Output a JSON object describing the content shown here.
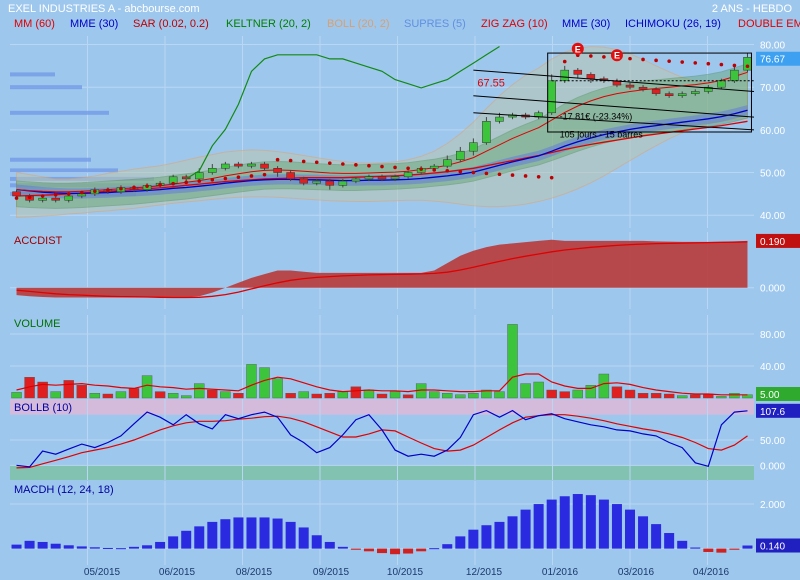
{
  "header": {
    "title": "EXEL INDUSTRIES A - abcbourse.com",
    "period": "2 ANS - HEBDO"
  },
  "legend": [
    {
      "label": "MM (60)",
      "color": "#e00000"
    },
    {
      "label": "MME (30)",
      "color": "#0000c8"
    },
    {
      "label": "SAR (0.02, 0.2)",
      "color": "#c00000"
    },
    {
      "label": "KELTNER (20, 2)",
      "color": "#008000"
    },
    {
      "label": "BOLL (20, 2)",
      "color": "#d8a070"
    },
    {
      "label": "SUPRES (5)",
      "color": "#6090e0"
    },
    {
      "label": "ZIG ZAG (10)",
      "color": "#e00000"
    },
    {
      "label": "MME (30)",
      "color": "#0000c8"
    },
    {
      "label": "ICHIMOKU (26, 19)",
      "color": "#0000c8"
    },
    {
      "label": "DOUBLE EM",
      "color": "#e00000"
    }
  ],
  "x_labels": [
    "05/2015",
    "06/2015",
    "08/2015",
    "09/2015",
    "10/2015",
    "12/2015",
    "01/2016",
    "03/2016",
    "04/2016"
  ],
  "chart_data": [
    {
      "type": "line",
      "name": "price",
      "y_ticks": [
        "80.00",
        "70.00",
        "60.00",
        "50.00",
        "40.00"
      ],
      "ylim": [
        37,
        82
      ],
      "last_value": "76.67",
      "annotations": {
        "level": "67.55",
        "change": "-17.81€ (-23.34%)",
        "duration": "105 jours - 15 barres",
        "markers": [
          "E",
          "E"
        ]
      },
      "candles": [
        [
          45.5,
          44.5,
          46,
          44
        ],
        [
          44.5,
          43.5,
          45,
          43
        ],
        [
          43.5,
          44,
          44.5,
          43
        ],
        [
          44,
          43.5,
          44.5,
          43
        ],
        [
          43.5,
          44.5,
          45,
          43
        ],
        [
          44.5,
          45,
          45.5,
          44
        ],
        [
          45,
          46,
          46.5,
          44.5
        ],
        [
          46,
          45.5,
          46.5,
          45
        ],
        [
          45.5,
          46.5,
          47,
          45
        ],
        [
          46.5,
          46,
          47,
          45.5
        ],
        [
          46,
          47,
          47.5,
          45.5
        ],
        [
          47,
          47.5,
          48,
          46.5
        ],
        [
          47.5,
          49,
          49.5,
          47
        ],
        [
          49,
          48.5,
          49.5,
          48
        ],
        [
          48.5,
          50,
          51,
          48
        ],
        [
          50,
          51,
          52,
          49.5
        ],
        [
          51,
          52,
          52.5,
          50.5
        ],
        [
          52,
          51.5,
          52.5,
          51
        ],
        [
          51.5,
          52,
          52.5,
          51
        ],
        [
          52,
          51,
          52.5,
          50.5
        ],
        [
          51,
          50,
          51.5,
          49
        ],
        [
          50,
          48.5,
          50.5,
          48
        ],
        [
          48.5,
          47.5,
          49,
          47
        ],
        [
          47.5,
          48,
          48.5,
          47
        ],
        [
          48,
          47,
          48.5,
          46
        ],
        [
          47,
          48,
          48.5,
          46.5
        ],
        [
          48,
          48.5,
          49,
          47.5
        ],
        [
          48.5,
          49,
          49.5,
          48
        ],
        [
          49,
          48.5,
          49.5,
          48
        ],
        [
          48.5,
          49,
          49.5,
          48
        ],
        [
          49,
          50,
          50.5,
          48.5
        ],
        [
          50,
          51,
          51.5,
          49.5
        ],
        [
          51,
          51.5,
          52,
          50.5
        ],
        [
          51.5,
          53,
          54,
          51
        ],
        [
          53,
          55,
          56,
          52.5
        ],
        [
          55,
          57,
          58,
          54
        ],
        [
          57,
          62,
          63,
          56.5
        ],
        [
          62,
          63,
          64,
          61.5
        ],
        [
          63,
          63.5,
          64,
          62.5
        ],
        [
          63.5,
          63,
          64,
          62.5
        ],
        [
          63,
          64,
          64.5,
          62.5
        ],
        [
          64,
          71.5,
          73,
          63.5
        ],
        [
          71.5,
          74,
          75,
          71
        ],
        [
          74,
          73,
          74.5,
          72
        ],
        [
          73,
          72,
          73.5,
          71
        ],
        [
          72,
          71.5,
          72.5,
          71
        ],
        [
          71.5,
          70.5,
          72,
          70
        ],
        [
          70.5,
          70,
          71,
          69.5
        ],
        [
          70,
          69.5,
          70.5,
          69
        ],
        [
          69.5,
          68.5,
          70,
          68
        ],
        [
          68.5,
          68,
          69,
          67.5
        ],
        [
          68,
          68.5,
          69,
          67.5
        ],
        [
          68.5,
          69,
          69.5,
          68
        ],
        [
          69,
          70,
          70.5,
          68.5
        ],
        [
          70,
          71.5,
          72,
          69.5
        ],
        [
          71.5,
          74,
          75,
          71
        ],
        [
          74,
          77,
          78,
          73.5
        ]
      ],
      "mm60": [
        44.5,
        44.6,
        44.7,
        44.8,
        45,
        45.2,
        45.4,
        45.6,
        45.8,
        46,
        46.2,
        46.4,
        46.7,
        47,
        47.3,
        47.6,
        47.9,
        48.1,
        48.3,
        48.5,
        48.6,
        48.7,
        48.8,
        48.8,
        48.8,
        48.8,
        48.9,
        49,
        49.1,
        49.2,
        49.4,
        49.6,
        49.9,
        50.2,
        50.6,
        51,
        51.6,
        52.2,
        52.8,
        53.4,
        54,
        54.7,
        55.4,
        56,
        56.6,
        57.1,
        57.6,
        58.1,
        58.6,
        59,
        59.4,
        59.8,
        60.2,
        60.6,
        61,
        61.5,
        62
      ],
      "mme30": [
        46,
        45.7,
        45.4,
        45.2,
        45.1,
        45.1,
        45.2,
        45.3,
        45.5,
        45.6,
        45.8,
        46,
        46.3,
        46.5,
        46.8,
        47.1,
        47.5,
        47.8,
        48.1,
        48.3,
        48.4,
        48.4,
        48.3,
        48.3,
        48.2,
        48.1,
        48.1,
        48.2,
        48.2,
        48.3,
        48.4,
        48.6,
        48.9,
        49.2,
        49.6,
        50.1,
        50.9,
        51.7,
        52.5,
        53.2,
        53.9,
        55,
        56.2,
        57.2,
        58.1,
        58.9,
        59.5,
        60.1,
        60.6,
        61,
        61.4,
        61.8,
        62.2,
        62.6,
        63.1,
        63.8,
        64.6
      ],
      "sar": [
        44,
        44.2,
        44.5,
        44.8,
        45,
        45.3,
        45.6,
        45.9,
        46.2,
        46.5,
        46.8,
        47.1,
        47.4,
        47.7,
        48,
        48.3,
        48.6,
        48.9,
        49.2,
        49.5,
        53,
        52.8,
        52.6,
        52.4,
        52.2,
        52,
        51.8,
        51.6,
        51.4,
        51.2,
        51,
        50.8,
        50.6,
        50.4,
        50.2,
        50,
        49.8,
        49.6,
        49.4,
        49.2,
        49,
        48.8,
        76,
        77.5,
        77.3,
        77.1,
        76.9,
        76.7,
        76.5,
        76.3,
        76.1,
        75.9,
        75.7,
        75.5,
        75.3,
        75.1,
        74.9
      ],
      "keltner_upper": [
        48,
        47.8,
        47.6,
        47.5,
        47.5,
        47.6,
        47.8,
        48,
        48.2,
        48.4,
        48.6,
        48.9,
        49.3,
        49.7,
        50.1,
        50.6,
        51.2,
        51.7,
        52.2,
        52.5,
        52.6,
        52.5,
        52.3,
        52.1,
        51.9,
        51.8,
        51.8,
        51.9,
        52,
        52.1,
        52.3,
        52.7,
        53.1,
        53.7,
        54.5,
        55.5,
        57,
        58.5,
        60,
        61.3,
        62.5,
        64.3,
        66.1,
        67.6,
        68.8,
        69.8,
        70.5,
        71,
        71.4,
        71.7,
        72,
        72.3,
        72.6,
        73,
        73.6,
        74.5,
        75.5
      ],
      "keltner_lower": [
        42,
        41.8,
        41.7,
        41.6,
        41.7,
        41.8,
        42,
        42.2,
        42.4,
        42.6,
        42.9,
        43.2,
        43.5,
        43.8,
        44.2,
        44.6,
        45,
        45.4,
        45.8,
        46.1,
        46.2,
        46.2,
        46.1,
        46,
        45.9,
        45.8,
        45.8,
        45.9,
        46,
        46.1,
        46.3,
        46.5,
        46.8,
        47.1,
        47.5,
        48,
        48.8,
        49.6,
        50.4,
        51.1,
        51.8,
        52.8,
        53.9,
        55,
        56,
        56.9,
        57.6,
        58.2,
        58.7,
        59.2,
        59.6,
        60,
        60.4,
        60.8,
        61.3,
        62,
        62.8
      ],
      "boll_upper": [
        50,
        49.5,
        49,
        48.5,
        48.5,
        48.8,
        49.2,
        49.8,
        50.3,
        50.8,
        51.2,
        51.6,
        52.2,
        52.9,
        53.6,
        54.2,
        54.8,
        55.1,
        55.3,
        55.2,
        54.9,
        54.5,
        54,
        53.5,
        53,
        52.6,
        52.3,
        52.2,
        52.3,
        52.5,
        53,
        53.8,
        55,
        56.8,
        59.1,
        61.8,
        65,
        68,
        70.6,
        72.8,
        74.5,
        76.6,
        78.2,
        79.1,
        79.5,
        79.4,
        78.8,
        77.8,
        76.5,
        75,
        73.6,
        72.3,
        71.4,
        71,
        71.3,
        72.4,
        74.2
      ],
      "boll_lower": [
        39.5,
        39.6,
        39.8,
        40,
        40.3,
        40.5,
        40.8,
        41,
        41.3,
        41.6,
        42,
        42.4,
        42.8,
        43.1,
        43.4,
        43.7,
        44,
        44.2,
        44.3,
        44.3,
        44.2,
        44,
        43.8,
        43.6,
        43.4,
        43.3,
        43.2,
        43.2,
        43.3,
        43.4,
        43.5,
        43.5,
        43.3,
        43,
        42.6,
        42.2,
        42,
        42,
        42.2,
        42.6,
        43.2,
        44,
        45,
        46.2,
        47.6,
        49.2,
        51,
        52.8,
        54.6,
        56.3,
        57.9,
        59.3,
        60.5,
        61.4,
        62,
        62.4,
        62.7
      ],
      "supres_levels": [
        [
          50.5,
          60
        ],
        [
          48.5,
          80
        ],
        [
          47,
          100
        ],
        [
          45,
          70
        ],
        [
          53,
          45
        ],
        [
          73,
          25
        ],
        [
          70,
          40
        ],
        [
          64,
          55
        ]
      ]
    },
    {
      "type": "area",
      "name": "ACCDIST",
      "y_ticks": [
        "0.000"
      ],
      "ylim": [
        -0.05,
        0.21
      ],
      "last_value": "0.190",
      "values": [
        -0.03,
        -0.035,
        -0.038,
        -0.04,
        -0.04,
        -0.04,
        -0.04,
        -0.04,
        -0.04,
        -0.04,
        -0.04,
        -0.04,
        -0.04,
        -0.04,
        -0.035,
        -0.02,
        0.0,
        0.02,
        0.04,
        0.055,
        0.07,
        0.07,
        0.065,
        0.06,
        0.06,
        0.06,
        0.06,
        0.06,
        0.06,
        0.06,
        0.06,
        0.06,
        0.07,
        0.1,
        0.13,
        0.15,
        0.165,
        0.175,
        0.18,
        0.185,
        0.19,
        0.195,
        0.19,
        0.19,
        0.19,
        0.19,
        0.19,
        0.19,
        0.19,
        0.188,
        0.187,
        0.186,
        0.186,
        0.186,
        0.187,
        0.188,
        0.19
      ],
      "signal": [
        -0.01,
        -0.015,
        -0.02,
        -0.025,
        -0.028,
        -0.03,
        -0.033,
        -0.035,
        -0.036,
        -0.037,
        -0.038,
        -0.039,
        -0.04,
        -0.04,
        -0.039,
        -0.035,
        -0.028,
        -0.018,
        -0.005,
        0.008,
        0.02,
        0.03,
        0.037,
        0.042,
        0.045,
        0.048,
        0.05,
        0.052,
        0.053,
        0.054,
        0.055,
        0.056,
        0.058,
        0.063,
        0.072,
        0.083,
        0.095,
        0.107,
        0.118,
        0.128,
        0.137,
        0.146,
        0.153,
        0.159,
        0.164,
        0.168,
        0.172,
        0.175,
        0.177,
        0.179,
        0.18,
        0.181,
        0.182,
        0.183,
        0.184,
        0.185,
        0.186
      ]
    },
    {
      "type": "bar",
      "name": "VOLUME",
      "y_ticks": [
        "80.00",
        "40.00"
      ],
      "ylim": [
        0,
        100
      ],
      "last_value": "5.00",
      "values": [
        7,
        26,
        20,
        8,
        22,
        16,
        6,
        5,
        8,
        12,
        28,
        8,
        6,
        3,
        18,
        10,
        8,
        6,
        42,
        38,
        24,
        6,
        8,
        5,
        6,
        8,
        14,
        10,
        5,
        8,
        4,
        18,
        8,
        6,
        4,
        6,
        10,
        8,
        92,
        18,
        20,
        10,
        8,
        10,
        16,
        30,
        14,
        10,
        6,
        6,
        5,
        3,
        4,
        5,
        2,
        6,
        4
      ],
      "up": [
        1,
        0,
        0,
        1,
        0,
        0,
        1,
        0,
        1,
        0,
        1,
        0,
        1,
        1,
        1,
        0,
        1,
        0,
        1,
        1,
        1,
        0,
        1,
        0,
        0,
        1,
        0,
        1,
        0,
        1,
        0,
        1,
        1,
        1,
        1,
        1,
        1,
        1,
        1,
        1,
        1,
        0,
        0,
        1,
        1,
        1,
        0,
        0,
        0,
        0,
        0,
        1,
        0,
        0,
        1,
        1,
        1
      ],
      "ma": [
        10,
        14,
        17,
        16,
        17,
        18,
        16,
        15,
        13,
        12,
        16,
        14,
        13,
        11,
        12,
        11,
        10,
        9,
        16,
        22,
        26,
        24,
        19,
        14,
        10,
        8,
        9,
        10,
        9,
        9,
        8,
        10,
        10,
        9,
        8,
        8,
        9,
        9,
        26,
        30,
        30,
        20,
        15,
        12,
        12,
        18,
        19,
        17,
        13,
        10,
        8,
        6,
        5,
        5,
        4,
        4,
        4
      ]
    },
    {
      "type": "line",
      "name": "BOLLB (10)",
      "y_ticks": [
        "50.00",
        "0.000"
      ],
      "ylim": [
        -25,
        125
      ],
      "last_value": "107.6",
      "values": [
        0,
        -3,
        28,
        22,
        32,
        42,
        35,
        45,
        58,
        82,
        105,
        95,
        80,
        100,
        82,
        72,
        100,
        92,
        100,
        105,
        95,
        60,
        45,
        25,
        35,
        60,
        90,
        100,
        70,
        30,
        18,
        22,
        18,
        30,
        55,
        100,
        108,
        95,
        108,
        90,
        98,
        102,
        92,
        86,
        80,
        76,
        70,
        68,
        62,
        58,
        45,
        35,
        5,
        -2,
        80,
        105,
        107.6
      ],
      "signal": [
        -5,
        -4,
        3,
        10,
        17,
        25,
        30,
        35,
        42,
        50,
        60,
        70,
        78,
        84,
        87,
        87,
        88,
        91,
        93,
        96,
        97,
        93,
        86,
        76,
        66,
        56,
        56,
        62,
        70,
        68,
        56,
        44,
        33,
        28,
        30,
        40,
        55,
        70,
        84,
        95,
        98,
        100,
        100,
        97,
        93,
        88,
        82,
        77,
        72,
        68,
        62,
        55,
        45,
        33,
        30,
        40,
        58
      ],
      "band_high": 100,
      "band_low": 0
    },
    {
      "type": "bar",
      "name": "MACDH (12, 24, 18)",
      "y_ticks": [
        "2.000",
        "0.000"
      ],
      "ylim": [
        -0.6,
        2.9
      ],
      "last_value": "0.140",
      "values": [
        0.18,
        0.35,
        0.3,
        0.22,
        0.15,
        0.1,
        0.06,
        0.03,
        0.02,
        0.08,
        0.15,
        0.3,
        0.55,
        0.8,
        1.0,
        1.2,
        1.32,
        1.4,
        1.4,
        1.4,
        1.35,
        1.2,
        0.95,
        0.6,
        0.3,
        0.08,
        -0.05,
        -0.12,
        -0.2,
        -0.25,
        -0.22,
        -0.12,
        0.02,
        0.2,
        0.55,
        0.85,
        1.05,
        1.2,
        1.45,
        1.75,
        2.0,
        2.2,
        2.35,
        2.45,
        2.4,
        2.2,
        2.0,
        1.75,
        1.45,
        1.1,
        0.7,
        0.35,
        0.05,
        -0.15,
        -0.18,
        -0.05,
        0.14
      ]
    }
  ]
}
